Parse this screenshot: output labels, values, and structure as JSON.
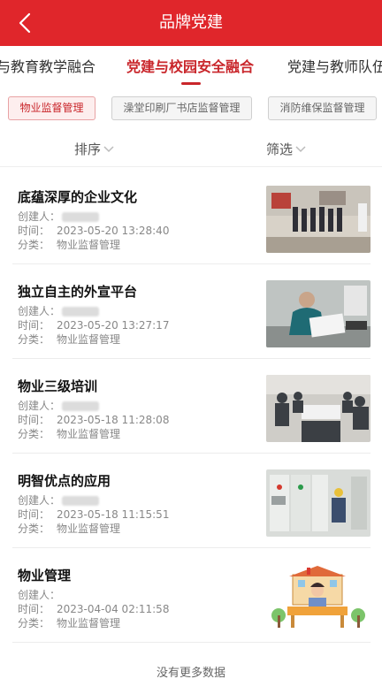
{
  "header": {
    "title": "品牌党建",
    "back_icon": "back-arrow-icon",
    "bg_color": "#e0262b"
  },
  "tabs": [
    {
      "label": "与教育教学融合",
      "active": false
    },
    {
      "label": "党建与校园安全融合",
      "active": true
    },
    {
      "label": "党建与教师队伍",
      "active": false
    }
  ],
  "chips": [
    {
      "label": "物业监督管理",
      "active": true
    },
    {
      "label": "澡堂印刷厂书店监督管理",
      "active": false
    },
    {
      "label": "消防维保监督管理",
      "active": false
    }
  ],
  "sortbar": {
    "sort_label": "排序",
    "filter_label": "筛选"
  },
  "meta_labels": {
    "creator": "创建人：",
    "time": "时间：",
    "category": "分类："
  },
  "items": [
    {
      "title": "底蕴深厚的企业文化",
      "time": "2023-05-20 13:28:40",
      "category": "物业监督管理",
      "image": "meeting-room-photo"
    },
    {
      "title": "独立自主的外宣平台",
      "time": "2023-05-20 13:27:17",
      "category": "物业监督管理",
      "image": "office-worker-photo"
    },
    {
      "title": "物业三级培训",
      "time": "2023-05-18 11:28:08",
      "category": "物业监督管理",
      "image": "training-session-photo"
    },
    {
      "title": "明智优点的应用",
      "time": "2023-05-18 11:15:51",
      "category": "物业监督管理",
      "image": "electrical-room-photo"
    },
    {
      "title": "物业管理",
      "time": "2023-04-04 02:11:58",
      "category": "物业监督管理",
      "image": "property-illustration"
    }
  ],
  "footer": {
    "no_more": "没有更多数据"
  },
  "colors": {
    "accent": "#c9262b"
  }
}
